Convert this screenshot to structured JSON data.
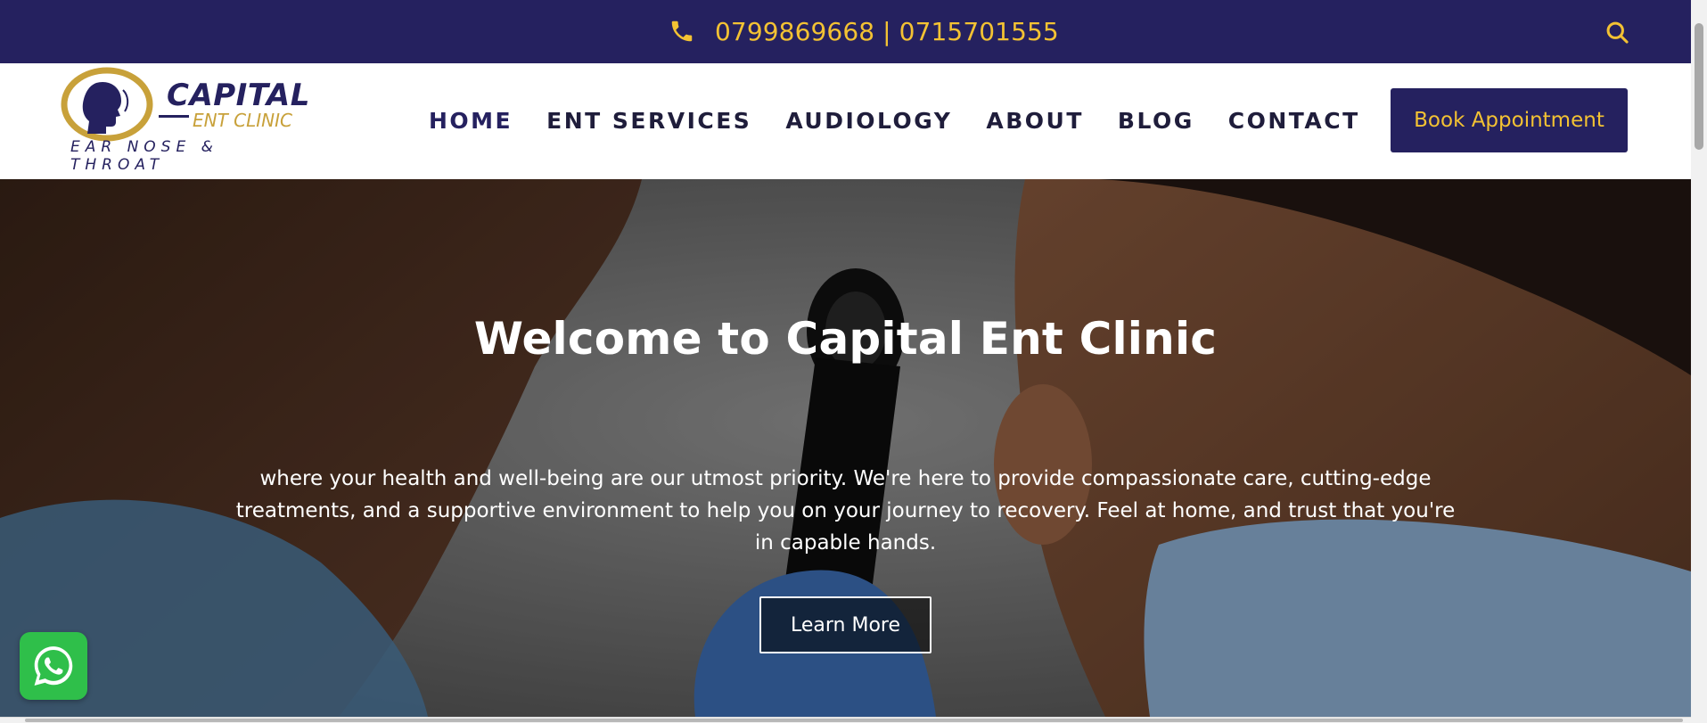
{
  "topbar": {
    "phone_text": "0799869668 | 0715701555",
    "phone_icon": "phone-icon",
    "search_icon": "search-icon"
  },
  "header": {
    "logo": {
      "brand": "CAPITAL",
      "sub": "ENT CLINIC",
      "tagline": "EAR NOSE & THROAT"
    },
    "nav": [
      {
        "label": "HOME"
      },
      {
        "label": "ENT SERVICES"
      },
      {
        "label": "AUDIOLOGY"
      },
      {
        "label": "ABOUT"
      },
      {
        "label": "BLOG"
      },
      {
        "label": "CONTACT"
      }
    ],
    "book_label": "Book Appointment"
  },
  "hero": {
    "title": "Welcome to Capital Ent Clinic",
    "text": "where your health and well-being are our utmost priority. We're here to provide compassionate care, cutting-edge treatments, and a supportive environment to help you on your journey to recovery. Feel at home, and trust that you're in capable hands.",
    "cta_label": "Learn More"
  },
  "colors": {
    "primary": "#25215f",
    "accent": "#f3c233",
    "whatsapp": "#2fbf4a"
  }
}
